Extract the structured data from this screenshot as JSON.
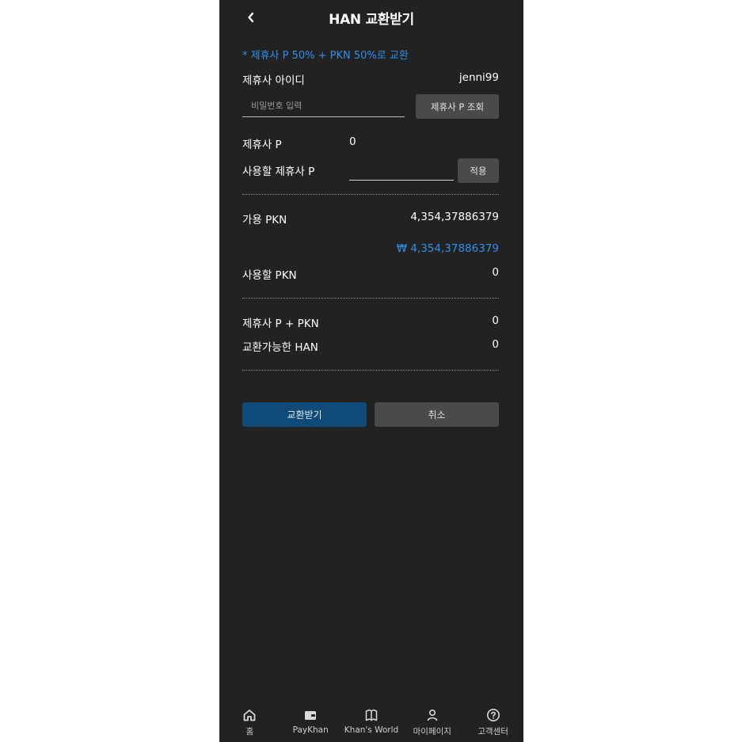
{
  "header": {
    "title": "HAN 교환받기",
    "back_icon": "chevron-left-icon"
  },
  "notice": "* 제휴사 P 50% + PKN 50%로 교환",
  "partner": {
    "id_label": "제휴사 아이디",
    "id_value": "jenni99",
    "password_placeholder": "비밀번호 입력",
    "lookup_button": "제휴사 P 조회",
    "points_label": "제휴사 P",
    "points_value": "0",
    "use_label": "사용할 제휴사 P",
    "use_value": "",
    "apply_button": "적용"
  },
  "pkn": {
    "available_label": "가용 PKN",
    "available_value": "4,354,37886379",
    "won_value": "₩ 4,354,37886379",
    "use_label": "사용할 PKN",
    "use_value": "0"
  },
  "summary": {
    "sum_label": "제휴사 P + PKN",
    "sum_value": "0",
    "han_label": "교환가능한 HAN",
    "han_value": "0"
  },
  "actions": {
    "confirm": "교환받기",
    "cancel": "취소"
  },
  "nav": [
    {
      "label": "홈",
      "icon": "home-icon"
    },
    {
      "label": "PayKhan",
      "icon": "wallet-icon"
    },
    {
      "label": "Khan's World",
      "icon": "book-icon"
    },
    {
      "label": "마이페이지",
      "icon": "person-icon"
    },
    {
      "label": "고객센터",
      "icon": "help-circle-icon"
    }
  ],
  "colors": {
    "background": "#222222",
    "accent": "#2f8fea",
    "primary_button": "#0f4a78",
    "secondary_button": "#4a4a4a"
  }
}
